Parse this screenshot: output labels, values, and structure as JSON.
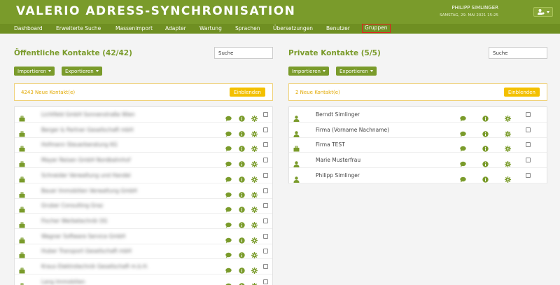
{
  "header": {
    "title": "VALERIO ADRESS-SYNCHRONISATION",
    "user_name": "PHILIPP SIMLINGER",
    "user_date": "SAMSTAG, 29. MAI 2021 15:25",
    "list_count": "0"
  },
  "nav": [
    "Dashboard",
    "Erweiterte Suche",
    "Massenimport",
    "Adapter",
    "Wartung",
    "Sprachen",
    "Übersetzungen",
    "Benutzer",
    "Gruppen"
  ],
  "public": {
    "title": "Öffentliche Kontakte (42/42)",
    "search_value": "Suche",
    "import_label": "Importieren",
    "export_label": "Exportieren",
    "notice": "4243 Neue Kontakt(e)",
    "notice_button": "Einblenden",
    "rows": [
      "Lichtfeld GmbH Sonnenstraße Wien",
      "Berger & Partner Gesellschaft mbH",
      "Hofmann Steuerberatung KG",
      "Mayer Reisen GmbH Nordbahnhof",
      "Schneider Verwaltung und Handel",
      "Bauer Immobilien Verwaltung GmbH",
      "Gruber Consulting Graz",
      "Fischer Werbetechnik OG",
      "Wagner Software Service GmbH",
      "Huber Transport Gesellschaft mbH",
      "Kraus Elektrotechnik Gesellschaft m.b.H.",
      "Lang Immobilien"
    ]
  },
  "private": {
    "title": "Private Kontakte (5/5)",
    "search_value": "Suche",
    "import_label": "Importieren",
    "export_label": "Exportieren",
    "notice": "2 Neue Kontakt(e)",
    "notice_button": "Einblenden",
    "rows": [
      {
        "name": "Berndt Simlinger",
        "icon": "person-icon"
      },
      {
        "name": "Firma (Vorname Nachname)",
        "icon": "person-icon"
      },
      {
        "name": "Firma TEST",
        "icon": "briefcase-icon"
      },
      {
        "name": "Marie Musterfrau",
        "icon": "person-icon"
      },
      {
        "name": "Philipp Simlinger",
        "icon": "person-icon"
      }
    ]
  },
  "colors": {
    "brand": "#7a9b2b",
    "nav": "#6f8f22",
    "notice": "#f3c000",
    "active_outline": "#e02020"
  }
}
